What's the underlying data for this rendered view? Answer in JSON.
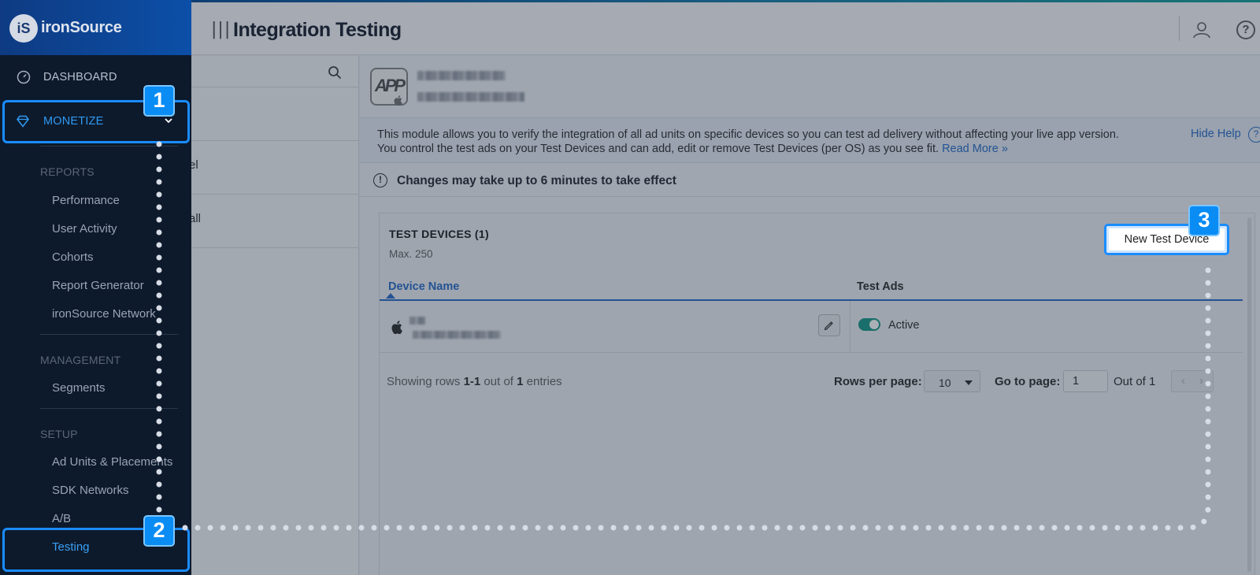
{
  "brand": {
    "name": "ironSource",
    "logo_text": "iS"
  },
  "header": {
    "title": "Integration Testing"
  },
  "sidebar": {
    "dashboard": "DASHBOARD",
    "monetize": "MONETIZE",
    "sections": [
      {
        "heading": "REPORTS",
        "items": [
          "Performance",
          "User Activity",
          "Cohorts",
          "Report Generator",
          "ironSource Network"
        ]
      },
      {
        "heading": "MANAGEMENT",
        "items": [
          "Segments"
        ]
      },
      {
        "heading": "SETUP",
        "items": [
          "Ad Units & Placements",
          "SDK Networks",
          "A/B",
          "Testing"
        ]
      }
    ],
    "active_item": "Testing"
  },
  "apps_column": {
    "row1_tail": "el",
    "row2_tail": "all"
  },
  "app": {
    "icon_text": "APP"
  },
  "help": {
    "line1": "This module allows you to verify the integration of all ad units on specific devices so you can test ad delivery without affecting your live app version.",
    "line2": "You control the test ads on your Test Devices and can add, edit or remove Test Devices (per OS) as you see fit.",
    "read_more": "Read More »",
    "hide_help": "Hide Help"
  },
  "notice": {
    "text": "Changes may take up to 6 minutes to take effect"
  },
  "test_devices": {
    "title": "TEST DEVICES (1)",
    "max": "Max. 250",
    "new_button": "New Test Device",
    "columns": [
      "Device Name",
      "Test Ads"
    ],
    "rows": [
      {
        "status": "Active",
        "enabled": true
      }
    ]
  },
  "pagination": {
    "showing_prefix": "Showing rows",
    "showing_range": "1-1",
    "showing_mid": "out of",
    "showing_total": "1",
    "showing_suffix": "entries",
    "rows_per_page_label": "Rows per page:",
    "rows_per_page_value": "10",
    "go_to_page_label": "Go to page:",
    "go_to_page_value": "1",
    "out_of": "Out of 1"
  },
  "callouts": {
    "one": "1",
    "two": "2",
    "three": "3"
  },
  "colors": {
    "accent": "#1a8cff",
    "sidebar_bg": "#0d1a2c",
    "link": "#2e6fc9",
    "toggle_on": "#1e9a8a"
  }
}
